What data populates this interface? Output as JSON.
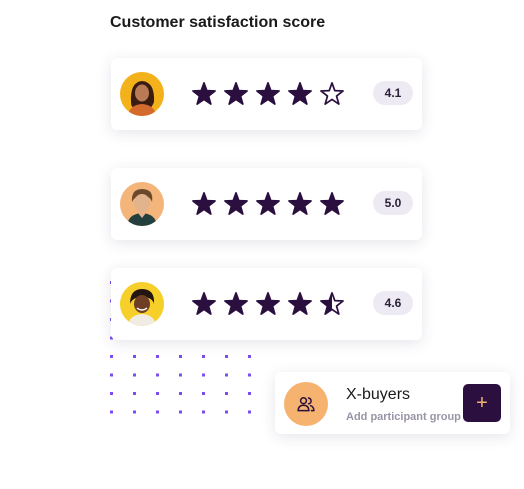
{
  "title": "Customer satisfaction score",
  "colors": {
    "star": "#2a0f3f",
    "badge_bg": "#eeeaf4",
    "dots": "#7b4cf0",
    "accent_orange": "#f6b370",
    "button_bg": "#2a0f3f"
  },
  "ratings": [
    {
      "avatar": "woman-avatar-icon",
      "stars": 4.0,
      "score": "4.1"
    },
    {
      "avatar": "man-avatar-icon",
      "stars": 5.0,
      "score": "5.0"
    },
    {
      "avatar": "woman-avatar-icon",
      "stars": 4.5,
      "score": "4.6"
    }
  ],
  "group_card": {
    "icon": "users-icon",
    "name": "X-buyers",
    "subtitle": "Add participant group",
    "add_label": "+"
  }
}
